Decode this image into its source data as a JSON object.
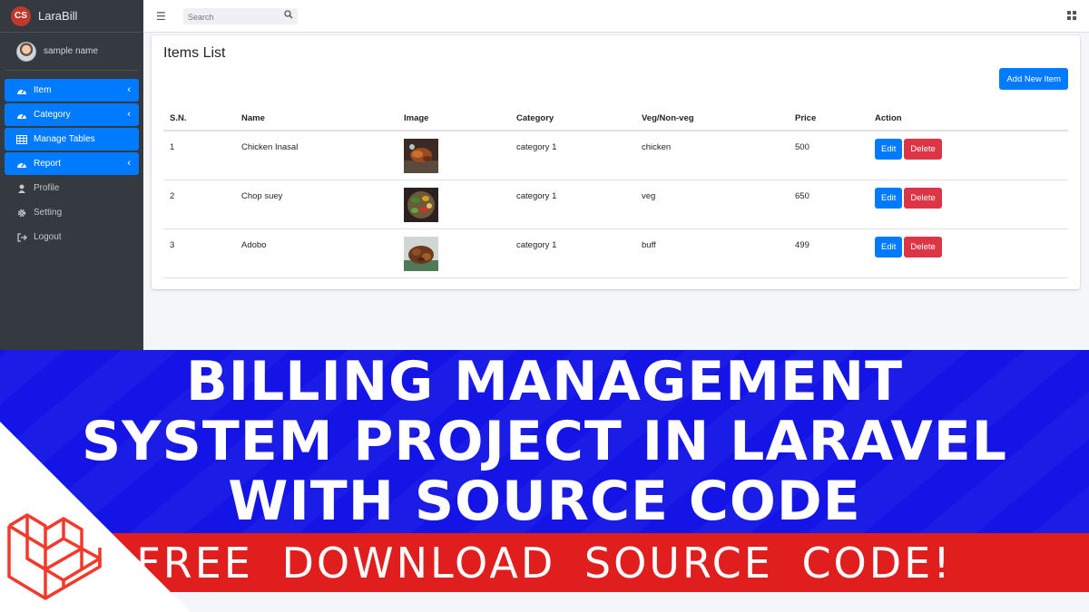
{
  "brand": {
    "name": "LaraBill",
    "logo_text": "CS"
  },
  "user": {
    "name": "sample name"
  },
  "sidebar": {
    "items": [
      {
        "label": "Item",
        "icon": "dashboard-icon",
        "active": true,
        "has_chevron": true
      },
      {
        "label": "Category",
        "icon": "dashboard-icon",
        "active": true,
        "has_chevron": true
      },
      {
        "label": "Manage Tables",
        "icon": "table-icon",
        "active": true,
        "has_chevron": false
      },
      {
        "label": "Report",
        "icon": "dashboard-icon",
        "active": true,
        "has_chevron": true
      },
      {
        "label": "Profile",
        "icon": "user-icon",
        "active": false,
        "has_chevron": false
      },
      {
        "label": "Setting",
        "icon": "gear-icon",
        "active": false,
        "has_chevron": false
      },
      {
        "label": "Logout",
        "icon": "logout-icon",
        "active": false,
        "has_chevron": false
      }
    ]
  },
  "topbar": {
    "search_placeholder": "Search"
  },
  "main": {
    "title": "Items List",
    "add_button": "Add New Item",
    "columns": [
      "S.N.",
      "Name",
      "Image",
      "Category",
      "Veg/Non-veg",
      "Price",
      "Action"
    ],
    "rows": [
      {
        "sn": "1",
        "name": "Chicken Inasal",
        "category": "category 1",
        "type": "chicken",
        "price": "500"
      },
      {
        "sn": "2",
        "name": "Chop suey",
        "category": "category 1",
        "type": "veg",
        "price": "650"
      },
      {
        "sn": "3",
        "name": "Adobo",
        "category": "category 1",
        "type": "buff",
        "price": "499"
      }
    ],
    "edit_label": "Edit",
    "delete_label": "Delete"
  },
  "banner": {
    "line1": "BILLING MANAGEMENT",
    "line2": "SYSTEM PROJECT IN LARAVEL",
    "line3": "WITH SOURCE CODE",
    "subline": "FREE DOWNLOAD SOURCE CODE!"
  },
  "colors": {
    "primary": "#007bff",
    "danger": "#dc3545",
    "sidebar_bg": "#343a40",
    "banner_blue": "#1414e6",
    "banner_red": "#e01e1e",
    "laravel_red": "#f4382a"
  }
}
